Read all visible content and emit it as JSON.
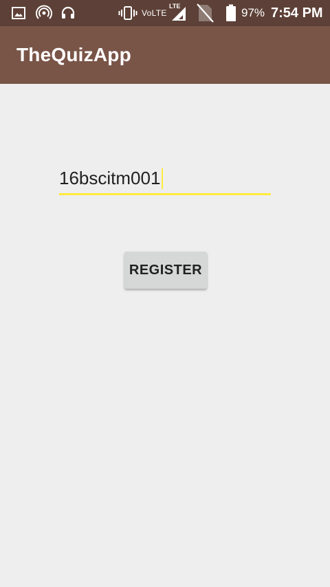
{
  "status_bar": {
    "background": "#5d4037",
    "icons_left": [
      "image-icon",
      "hotspot-icon",
      "headset-icon"
    ],
    "icons_right": [
      "vibrate-icon",
      "volte-icon",
      "signal-icon",
      "no-sim-icon",
      "battery-icon"
    ],
    "volte_label": "VoLTE",
    "lte_label": "LTE",
    "battery_level": 0.97,
    "battery_text": "97%",
    "time": "7:54 PM"
  },
  "app_bar": {
    "title": "TheQuizApp",
    "background": "#795548"
  },
  "form": {
    "input_value": "16bscitm001",
    "input_underline_color": "#ffeb3b",
    "register_label": "REGISTER"
  }
}
